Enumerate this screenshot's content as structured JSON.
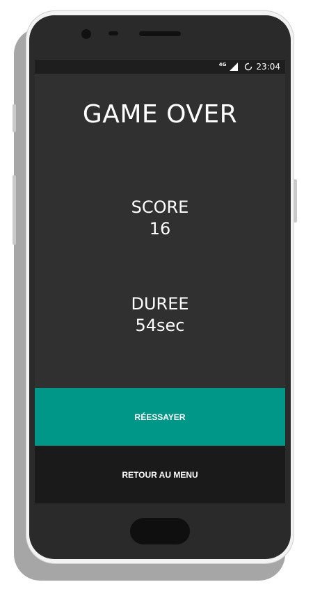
{
  "status_bar": {
    "network": "4G",
    "time": "23:04"
  },
  "game_over": {
    "title": "GAME OVER",
    "score_label": "SCORE",
    "score_value": "16",
    "duration_label": "DUREE",
    "duration_value": "54sec"
  },
  "buttons": {
    "retry_label": "RÉESSAYER",
    "menu_label": "RETOUR AU MENU"
  },
  "colors": {
    "screen_background": "#303030",
    "retry_button": "#009688",
    "menu_button": "#1a1a1a"
  }
}
